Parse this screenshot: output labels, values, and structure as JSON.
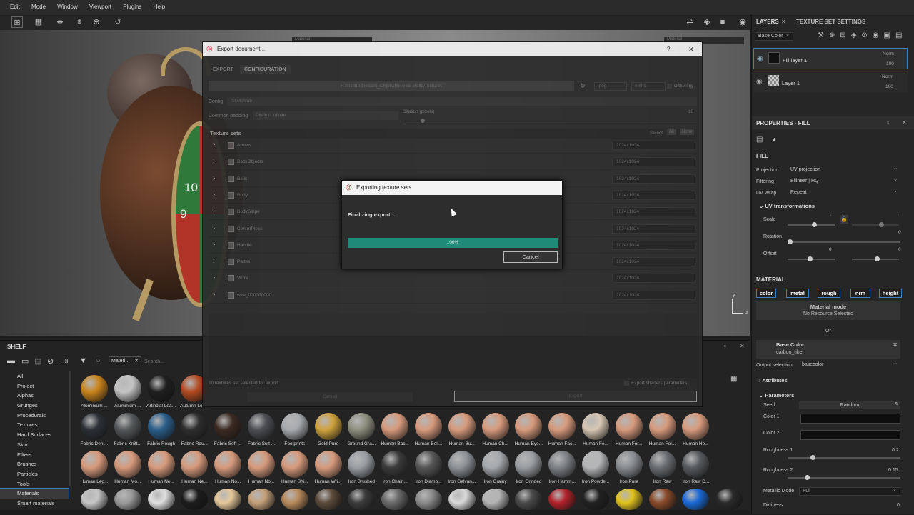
{
  "menu": [
    "Edit",
    "Mode",
    "Window",
    "Viewport",
    "Plugins",
    "Help"
  ],
  "viewport": {
    "material_dropdown": "Material",
    "material_dropdown2": "Material"
  },
  "right_panel": {
    "tab_layers": "LAYERS",
    "tab_tss": "TEXTURE SET SETTINGS",
    "channel_select": "Base Color",
    "layers": [
      {
        "name": "Fill layer 1",
        "blend": "Norm",
        "opacity": "100"
      },
      {
        "name": "Layer 1",
        "blend": "Norm",
        "opacity": "100"
      }
    ],
    "properties_title": "PROPERTIES - FILL",
    "fill_label": "FILL",
    "projection_label": "Projection",
    "projection_value": "UV projection",
    "filtering_label": "Filtering",
    "filtering_value": "Bilinear | HQ",
    "uvwrap_label": "UV Wrap",
    "uvwrap_value": "Repeat",
    "uvt_label": "UV transformations",
    "scale_label": "Scale",
    "scale_value": "1",
    "scale_value2": "1",
    "rotation_label": "Rotation",
    "rotation_value": "0",
    "offset_label": "Offset",
    "offset_value1": "0",
    "offset_value2": "0",
    "material_label": "MATERIAL",
    "channels": [
      "color",
      "metal",
      "rough",
      "nrm",
      "height"
    ],
    "material_mode": "Material mode",
    "no_resource": "No Resource Selected",
    "or": "Or",
    "base_color": "Base Color",
    "base_color_res": "carbon_fiber",
    "output_sel_label": "Output selection",
    "output_sel_value": "basecolor",
    "attributes": "Attributes",
    "parameters": "Parameters",
    "seed_label": "Seed",
    "seed_value": "Random",
    "color1": "Color 1",
    "color2": "Color 2",
    "roughness1_label": "Roughness 1",
    "roughness1_value": "0.2",
    "roughness2_label": "Roughness 2",
    "roughness2_value": "0.15",
    "metallic_label": "Metallic Mode",
    "metallic_value": "Full",
    "dirtiness_label": "Dirtiness",
    "dirtiness_value": "0"
  },
  "shelf": {
    "title": "SHELF",
    "filter_tag": "Materi...",
    "search_placeholder": "Search...",
    "categories": [
      "All",
      "Project",
      "Alphas",
      "Grunges",
      "Procedurals",
      "Textures",
      "Hard Surfaces",
      "Skin",
      "Filters",
      "Brushes",
      "Particles",
      "Tools",
      "Materials",
      "Smart materials"
    ],
    "selected_category": "Materials",
    "rows": [
      [
        {
          "name": "Aluminium ...",
          "color": "#c9841c"
        },
        {
          "name": "Aluminium ...",
          "color": "#c4c4c4"
        },
        {
          "name": "Artificial Lea...",
          "color": "#1f1f1f"
        },
        {
          "name": "Autumn Lea...",
          "color": "#b24a20"
        }
      ],
      [
        {
          "name": "Fabric Deni...",
          "color": "#2c3036"
        },
        {
          "name": "Fabric Knitt...",
          "color": "#55585a"
        },
        {
          "name": "Fabric Rough",
          "color": "#2a5e8a"
        },
        {
          "name": "Fabric Rou...",
          "color": "#2e2e2e"
        },
        {
          "name": "Fabric Soft ...",
          "color": "#3c2a22"
        },
        {
          "name": "Fabric Suit ...",
          "color": "#4c4e52"
        },
        {
          "name": "Footprints",
          "color": "#a8abae"
        },
        {
          "name": "Gold Pure",
          "color": "#cfa23c"
        },
        {
          "name": "Ground Gra...",
          "color": "#8f8f80"
        },
        {
          "name": "Human Bac...",
          "color": "#d79a7c"
        },
        {
          "name": "Human Bell...",
          "color": "#d79a7c"
        },
        {
          "name": "Human Bu...",
          "color": "#d79a7c"
        },
        {
          "name": "Human Ch...",
          "color": "#d79a7c"
        },
        {
          "name": "Human Eye...",
          "color": "#d79a7c"
        },
        {
          "name": "Human Fac...",
          "color": "#d79a7c"
        },
        {
          "name": "Human Fe...",
          "color": "#d8c7b3"
        },
        {
          "name": "Human For...",
          "color": "#d79a7c"
        },
        {
          "name": "Human For...",
          "color": "#d79a7c"
        },
        {
          "name": "Human He...",
          "color": "#d79a7c"
        }
      ],
      [
        {
          "name": "Human Leg...",
          "color": "#d79a7c"
        },
        {
          "name": "Human Mo...",
          "color": "#d79a7c"
        },
        {
          "name": "Human Ne...",
          "color": "#d79a7c"
        },
        {
          "name": "Human Ne...",
          "color": "#d79a7c"
        },
        {
          "name": "Human No...",
          "color": "#d79a7c"
        },
        {
          "name": "Human No...",
          "color": "#d79a7c"
        },
        {
          "name": "Human Shi...",
          "color": "#d79a7c"
        },
        {
          "name": "Human Wri...",
          "color": "#d79a7c"
        },
        {
          "name": "Iron Brushed",
          "color": "#9a9ea2"
        },
        {
          "name": "Iron Chain...",
          "color": "#3a3a3a"
        },
        {
          "name": "Iron Diamo...",
          "color": "#555"
        },
        {
          "name": "Iron Galvan...",
          "color": "#8e9296"
        },
        {
          "name": "Iron Grainy",
          "color": "#a6a9ac"
        },
        {
          "name": "Iron Grinded",
          "color": "#9a9da0"
        },
        {
          "name": "Iron Hamm...",
          "color": "#7e8185"
        },
        {
          "name": "Iron Powde...",
          "color": "#b4b6b8"
        },
        {
          "name": "Iron Pure",
          "color": "#8a8d90"
        },
        {
          "name": "Iron Raw",
          "color": "#6a6d70"
        },
        {
          "name": "Iron Raw D...",
          "color": "#575a5d"
        }
      ]
    ]
  },
  "export_dialog": {
    "title": "Export document...",
    "help": "?",
    "close": "✕",
    "tab_export": "EXPORT",
    "tab_config": "CONFIGURATION",
    "path": "H:/Institut Tuccarlj_Objets/Reveille Malle/Textures",
    "format": "jpeg",
    "bits": "8 bits",
    "dithering": "Dithering",
    "config_label": "Config",
    "config_value": "Sketchfab",
    "padding_label": "Common padding",
    "padding_value": "Dilation infinite",
    "dilation_label": "Dilation (pixels)",
    "dilation_value": "16",
    "texture_sets_label": "Texture sets",
    "select_label": "Select",
    "select_all": "All",
    "select_none": "None",
    "texture_sets": [
      "Arrows",
      "BackObjects",
      "Bells",
      "Body",
      "BodyStripe",
      "CenterPiece",
      "Handle",
      "Pattes",
      "Verre",
      "wire_000000000"
    ],
    "resolution": "1024x1024",
    "footer_text": "10 textures set selected for export",
    "export_shaders": "Export shaders parameters",
    "cancel": "Cancel",
    "export": "Export"
  },
  "progress_dialog": {
    "title": "Exporting texture sets",
    "status": "Finalizing export...",
    "progress_fraction": 1.0,
    "progress_text": "100%",
    "cancel": "Cancel"
  },
  "colors": {
    "accent": "#1f8a78",
    "panel": "#262626",
    "highlight_blue": "#3f7fbf"
  }
}
